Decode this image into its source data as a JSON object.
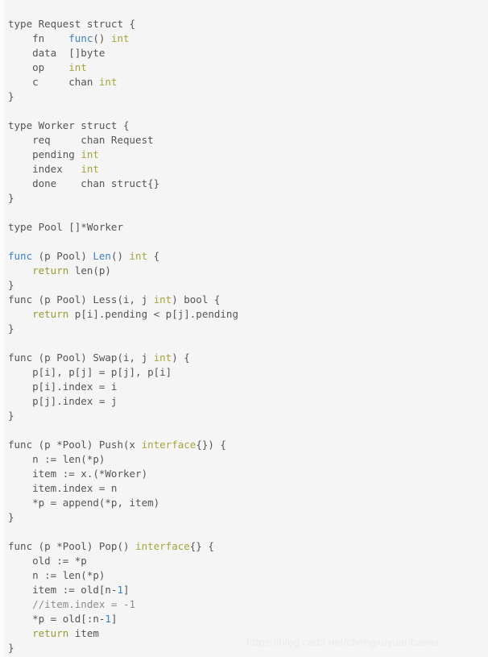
{
  "document": {
    "kind": "go-source-code-screenshot",
    "background_color": "#f5f5f5",
    "default_text_color": "#555555",
    "colors": {
      "keyword_blue": "#3b7fc4",
      "builtin_type_olive": "#a6a63c",
      "return_olive": "#9a9a33",
      "comment_gray": "#8c8c8c",
      "number_blue": "#3b7fc4",
      "watermark_gray": "#ececec"
    }
  },
  "watermark": {
    "text": "https://blog.csdn.net/chengxuyuanbawei"
  },
  "code": {
    "lines": [
      {
        "id": 1,
        "segments": [
          {
            "t": "type Request struct {",
            "c": "plain"
          }
        ]
      },
      {
        "id": 2,
        "segments": [
          {
            "t": "    fn    ",
            "c": "plain"
          },
          {
            "t": "func",
            "c": "kw"
          },
          {
            "t": "() ",
            "c": "plain"
          },
          {
            "t": "int",
            "c": "type"
          }
        ]
      },
      {
        "id": 3,
        "segments": [
          {
            "t": "    data  []byte",
            "c": "plain"
          }
        ]
      },
      {
        "id": 4,
        "segments": [
          {
            "t": "    op    ",
            "c": "plain"
          },
          {
            "t": "int",
            "c": "type"
          }
        ]
      },
      {
        "id": 5,
        "segments": [
          {
            "t": "    c     chan ",
            "c": "plain"
          },
          {
            "t": "int",
            "c": "type"
          }
        ]
      },
      {
        "id": 6,
        "segments": [
          {
            "t": "}",
            "c": "plain"
          }
        ]
      },
      {
        "id": 7,
        "segments": [
          {
            "t": "",
            "c": "plain"
          }
        ]
      },
      {
        "id": 8,
        "segments": [
          {
            "t": "type Worker struct {",
            "c": "plain"
          }
        ]
      },
      {
        "id": 9,
        "segments": [
          {
            "t": "    req     chan Request",
            "c": "plain"
          }
        ]
      },
      {
        "id": 10,
        "segments": [
          {
            "t": "    pending ",
            "c": "plain"
          },
          {
            "t": "int",
            "c": "type"
          }
        ]
      },
      {
        "id": 11,
        "segments": [
          {
            "t": "    index   ",
            "c": "plain"
          },
          {
            "t": "int",
            "c": "type"
          }
        ]
      },
      {
        "id": 12,
        "segments": [
          {
            "t": "    done    chan struct{}",
            "c": "plain"
          }
        ]
      },
      {
        "id": 13,
        "segments": [
          {
            "t": "}",
            "c": "plain"
          }
        ]
      },
      {
        "id": 14,
        "segments": [
          {
            "t": "",
            "c": "plain"
          }
        ]
      },
      {
        "id": 15,
        "segments": [
          {
            "t": "type Pool []*Worker",
            "c": "plain"
          }
        ]
      },
      {
        "id": 16,
        "segments": [
          {
            "t": "",
            "c": "plain"
          }
        ]
      },
      {
        "id": 17,
        "segments": [
          {
            "t": "func",
            "c": "kw"
          },
          {
            "t": " (p Pool) ",
            "c": "plain"
          },
          {
            "t": "Len",
            "c": "kw"
          },
          {
            "t": "() ",
            "c": "plain"
          },
          {
            "t": "int",
            "c": "type"
          },
          {
            "t": " {",
            "c": "plain"
          }
        ]
      },
      {
        "id": 18,
        "segments": [
          {
            "t": "    ",
            "c": "plain"
          },
          {
            "t": "return",
            "c": "ret"
          },
          {
            "t": " len(p)",
            "c": "plain"
          }
        ]
      },
      {
        "id": 19,
        "segments": [
          {
            "t": "}",
            "c": "plain"
          }
        ]
      },
      {
        "id": 20,
        "segments": [
          {
            "t": "func (p Pool) Less(i, j ",
            "c": "plain"
          },
          {
            "t": "int",
            "c": "type"
          },
          {
            "t": ") bool {",
            "c": "plain"
          }
        ]
      },
      {
        "id": 21,
        "segments": [
          {
            "t": "    ",
            "c": "plain"
          },
          {
            "t": "return",
            "c": "ret"
          },
          {
            "t": " p[i].pending < p[j].pending",
            "c": "plain"
          }
        ]
      },
      {
        "id": 22,
        "segments": [
          {
            "t": "}",
            "c": "plain"
          }
        ]
      },
      {
        "id": 23,
        "segments": [
          {
            "t": "",
            "c": "plain"
          }
        ]
      },
      {
        "id": 24,
        "segments": [
          {
            "t": "func (p Pool) Swap(i, j ",
            "c": "plain"
          },
          {
            "t": "int",
            "c": "type"
          },
          {
            "t": ") {",
            "c": "plain"
          }
        ]
      },
      {
        "id": 25,
        "segments": [
          {
            "t": "    p[i], p[j] = p[j], p[i]",
            "c": "plain"
          }
        ]
      },
      {
        "id": 26,
        "segments": [
          {
            "t": "    p[i].index = i",
            "c": "plain"
          }
        ]
      },
      {
        "id": 27,
        "segments": [
          {
            "t": "    p[j].index = j",
            "c": "plain"
          }
        ]
      },
      {
        "id": 28,
        "segments": [
          {
            "t": "}",
            "c": "plain"
          }
        ]
      },
      {
        "id": 29,
        "segments": [
          {
            "t": "",
            "c": "plain"
          }
        ]
      },
      {
        "id": 30,
        "segments": [
          {
            "t": "func (p *Pool) Push(x ",
            "c": "plain"
          },
          {
            "t": "interface",
            "c": "type"
          },
          {
            "t": "{}) {",
            "c": "plain"
          }
        ]
      },
      {
        "id": 31,
        "segments": [
          {
            "t": "    n := len(*p)",
            "c": "plain"
          }
        ]
      },
      {
        "id": 32,
        "segments": [
          {
            "t": "    item := x.(*Worker)",
            "c": "plain"
          }
        ]
      },
      {
        "id": 33,
        "segments": [
          {
            "t": "    item.index = n",
            "c": "plain"
          }
        ]
      },
      {
        "id": 34,
        "segments": [
          {
            "t": "    *p = append(*p, item)",
            "c": "plain"
          }
        ]
      },
      {
        "id": 35,
        "segments": [
          {
            "t": "}",
            "c": "plain"
          }
        ]
      },
      {
        "id": 36,
        "segments": [
          {
            "t": "",
            "c": "plain"
          }
        ]
      },
      {
        "id": 37,
        "segments": [
          {
            "t": "func (p *Pool) Pop() ",
            "c": "plain"
          },
          {
            "t": "interface",
            "c": "type"
          },
          {
            "t": "{} {",
            "c": "plain"
          }
        ]
      },
      {
        "id": 38,
        "segments": [
          {
            "t": "    old := *p",
            "c": "plain"
          }
        ]
      },
      {
        "id": 39,
        "segments": [
          {
            "t": "    n := len(*p)",
            "c": "plain"
          }
        ]
      },
      {
        "id": 40,
        "segments": [
          {
            "t": "    item := old[n-",
            "c": "plain"
          },
          {
            "t": "1",
            "c": "num"
          },
          {
            "t": "]",
            "c": "plain"
          }
        ]
      },
      {
        "id": 41,
        "segments": [
          {
            "t": "    //item.index = -1",
            "c": "comment"
          }
        ]
      },
      {
        "id": 42,
        "segments": [
          {
            "t": "    *p = old[:n-",
            "c": "plain"
          },
          {
            "t": "1",
            "c": "num"
          },
          {
            "t": "]",
            "c": "plain"
          }
        ]
      },
      {
        "id": 43,
        "segments": [
          {
            "t": "    ",
            "c": "plain"
          },
          {
            "t": "return",
            "c": "ret"
          },
          {
            "t": " item",
            "c": "plain"
          }
        ]
      },
      {
        "id": 44,
        "segments": [
          {
            "t": "}",
            "c": "plain"
          }
        ]
      }
    ]
  }
}
